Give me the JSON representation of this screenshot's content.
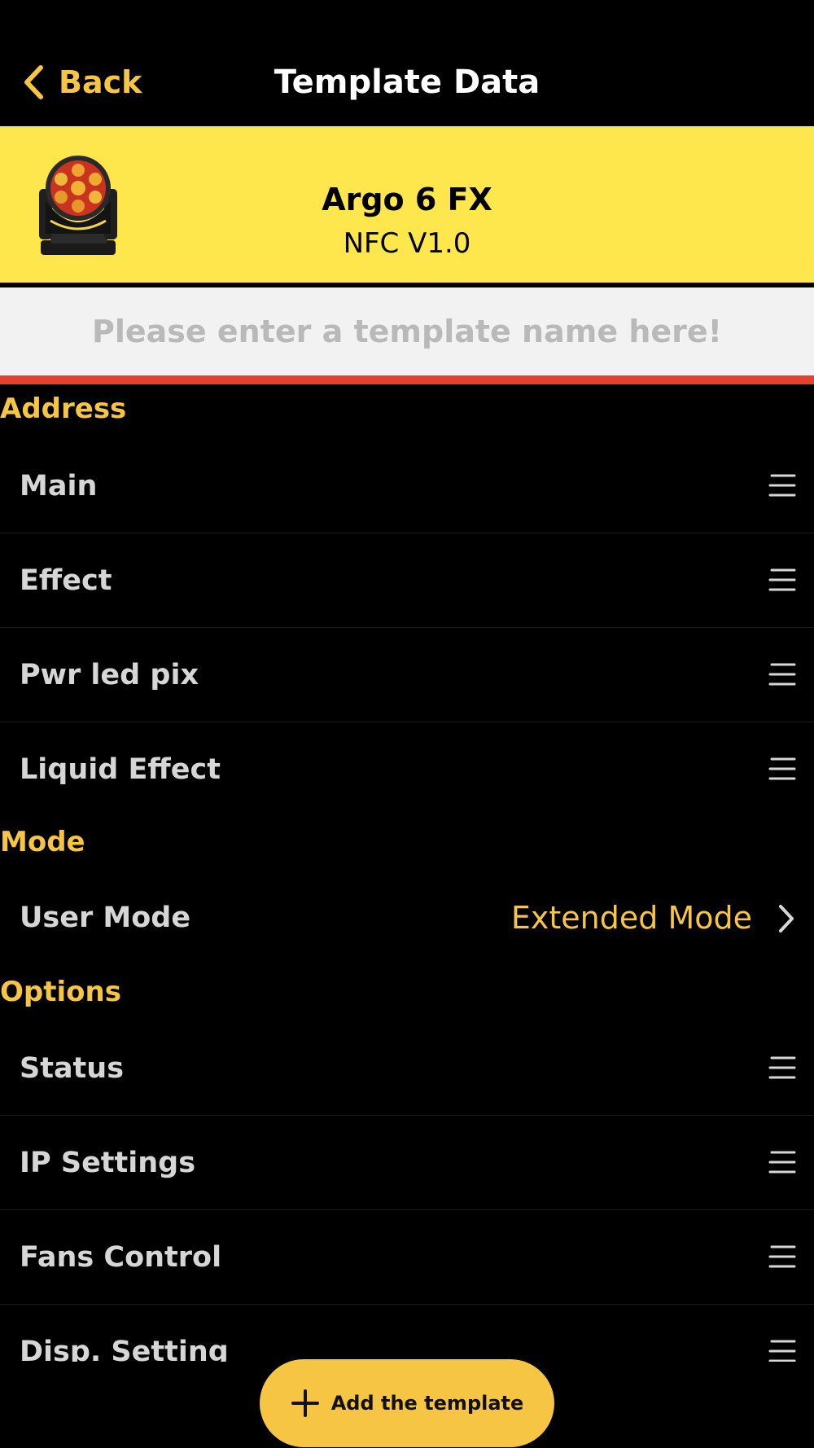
{
  "nav": {
    "back_label": "Back",
    "title": "Template Data"
  },
  "device": {
    "name": "Argo 6 FX",
    "version": "NFC V1.0"
  },
  "template_name": {
    "value": "",
    "placeholder": "Please enter a template name here!"
  },
  "sections": {
    "address": {
      "title": "Address",
      "items": [
        {
          "label": "Main",
          "icon": "menu-icon"
        },
        {
          "label": "Effect",
          "icon": "menu-icon"
        },
        {
          "label": "Pwr led pix",
          "icon": "menu-icon"
        },
        {
          "label": "Liquid Effect",
          "icon": "menu-icon"
        }
      ]
    },
    "mode": {
      "title": "Mode",
      "items": [
        {
          "label": "User Mode",
          "value": "Extended Mode",
          "icon": "chevron-right-icon"
        }
      ]
    },
    "options": {
      "title": "Options",
      "items": [
        {
          "label": "Status",
          "icon": "menu-icon"
        },
        {
          "label": "IP Settings",
          "icon": "menu-icon"
        },
        {
          "label": "Fans Control",
          "icon": "menu-icon"
        },
        {
          "label": "Disp. Setting",
          "icon": "menu-icon"
        }
      ]
    }
  },
  "footer": {
    "add_label": "Add the template"
  },
  "colors": {
    "accent": "#f6c544",
    "banner": "#fde74c",
    "input_underline": "#e8412b",
    "background": "#000000"
  }
}
